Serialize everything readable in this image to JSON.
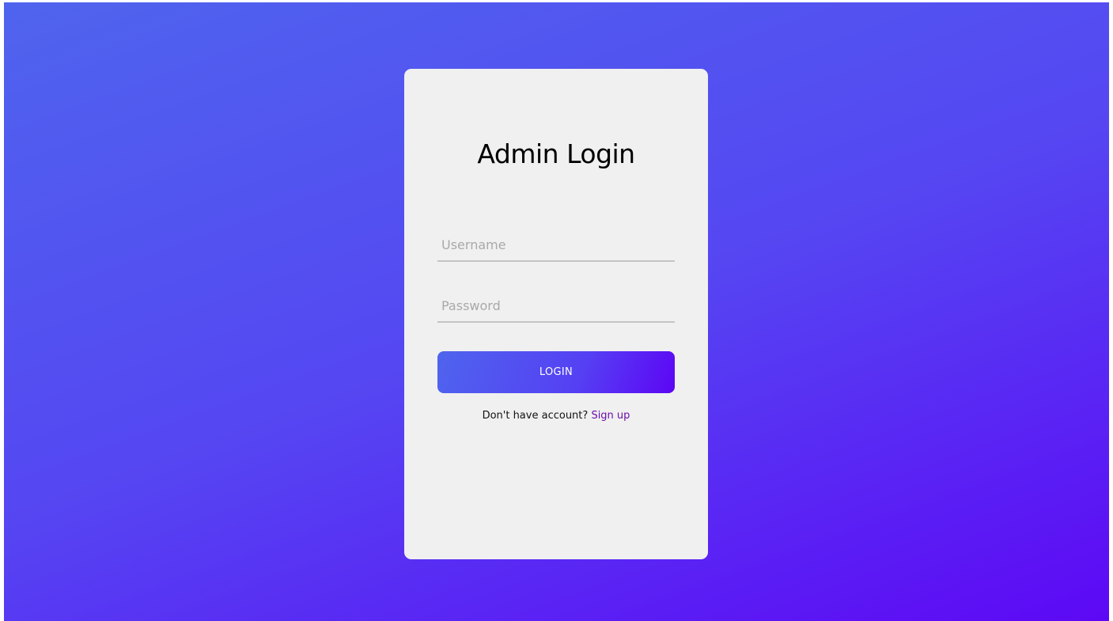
{
  "login_form": {
    "title": "Admin Login",
    "username": {
      "placeholder": "Username",
      "value": ""
    },
    "password": {
      "placeholder": "Password",
      "value": ""
    },
    "login_button_label": "LOGIN",
    "signup_prompt": "Don't have account?",
    "signup_link_label": "Sign up"
  },
  "colors": {
    "background_gradient_start": "#4f64ee",
    "background_gradient_end": "#5d08f5",
    "card_background": "#f0f0f0",
    "link_color": "#6a0dad",
    "input_underline": "#c4c4c4"
  }
}
